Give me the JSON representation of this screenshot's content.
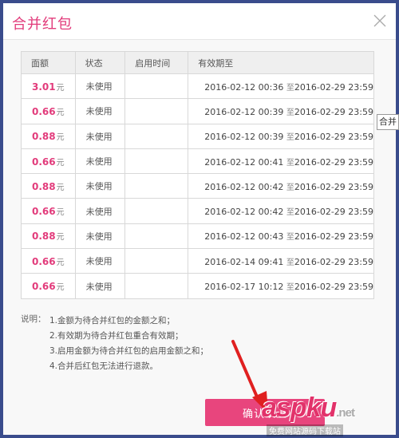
{
  "dialog": {
    "title": "合并红包",
    "columns": [
      "面额",
      "状态",
      "启用时间",
      "有效期至"
    ],
    "rows": [
      {
        "amount": "3.01",
        "unit": "元",
        "status": "未使用",
        "start": "",
        "valid_from": "2016-02-12 00:36",
        "sep": "至",
        "valid_to": "2016-02-29 23:59"
      },
      {
        "amount": "0.66",
        "unit": "元",
        "status": "未使用",
        "start": "",
        "valid_from": "2016-02-12 00:39",
        "sep": "至",
        "valid_to": "2016-02-29 23:59"
      },
      {
        "amount": "0.88",
        "unit": "元",
        "status": "未使用",
        "start": "",
        "valid_from": "2016-02-12 00:39",
        "sep": "至",
        "valid_to": "2016-02-29 23:59"
      },
      {
        "amount": "0.66",
        "unit": "元",
        "status": "未使用",
        "start": "",
        "valid_from": "2016-02-12 00:41",
        "sep": "至",
        "valid_to": "2016-02-29 23:59"
      },
      {
        "amount": "0.88",
        "unit": "元",
        "status": "未使用",
        "start": "",
        "valid_from": "2016-02-12 00:42",
        "sep": "至",
        "valid_to": "2016-02-29 23:59"
      },
      {
        "amount": "0.66",
        "unit": "元",
        "status": "未使用",
        "start": "",
        "valid_from": "2016-02-12 00:42",
        "sep": "至",
        "valid_to": "2016-02-29 23:59"
      },
      {
        "amount": "0.88",
        "unit": "元",
        "status": "未使用",
        "start": "",
        "valid_from": "2016-02-12 00:43",
        "sep": "至",
        "valid_to": "2016-02-29 23:59"
      },
      {
        "amount": "0.66",
        "unit": "元",
        "status": "未使用",
        "start": "",
        "valid_from": "2016-02-14 09:41",
        "sep": "至",
        "valid_to": "2016-02-29 23:59"
      },
      {
        "amount": "0.66",
        "unit": "元",
        "status": "未使用",
        "start": "",
        "valid_from": "2016-02-17 10:12",
        "sep": "至",
        "valid_to": "2016-02-29 23:59"
      }
    ],
    "notes_label": "说明：",
    "notes": [
      "1.金额为待合并红包的金额之和；",
      "2.有效期为待合并红包重合有效期；",
      "3.启用金额为待合并红包的启用金额之和；",
      "4.合并后红包无法进行退款。"
    ],
    "confirm_label": "确认以上",
    "tooltip": "合并"
  },
  "watermark": {
    "main": "aspku",
    "suffix": ".net",
    "sub": "免费网站源码下载站"
  },
  "colors": {
    "accent": "#e23b7b",
    "button": "#e8457d",
    "backdrop": "#3a4c8c",
    "arrow": "#e02020"
  },
  "icons": {
    "close": "close-icon",
    "arrow": "red-arrow-annotation"
  }
}
